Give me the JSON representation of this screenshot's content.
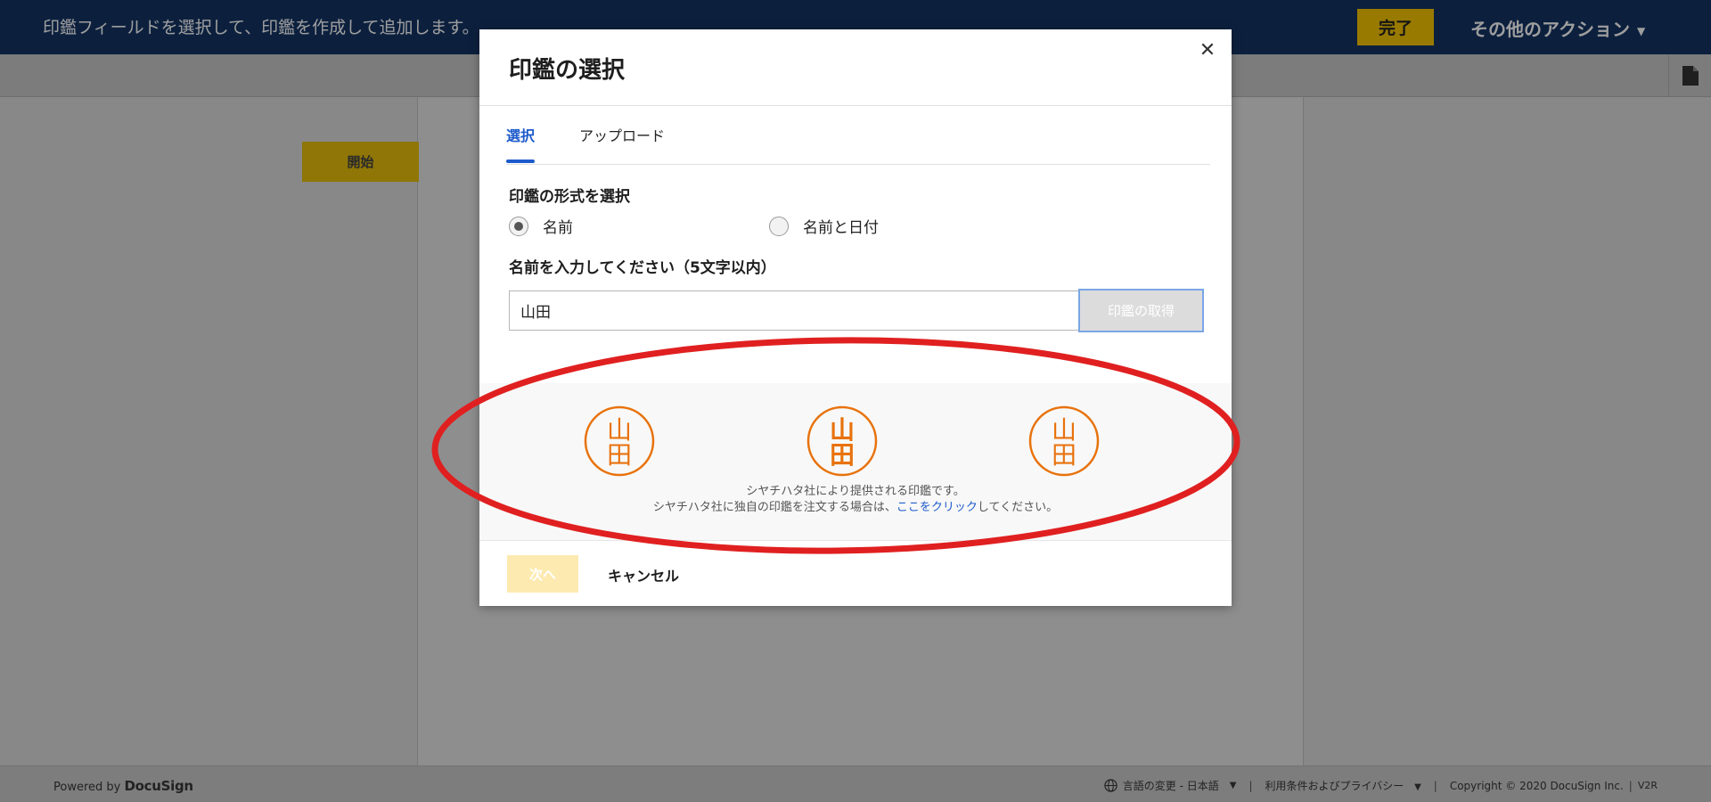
{
  "header": {
    "message": "印鑑フィールドを選択して、印鑑を作成して追加します。",
    "done_label": "完了",
    "other_actions_label": "その他のアクション",
    "other_actions_caret": "▼"
  },
  "toolbar": {
    "document_icon": "document-icon"
  },
  "document": {
    "start_label": "開始"
  },
  "modal": {
    "title": "印鑑の選択",
    "close_glyph": "✕",
    "tabs": [
      {
        "label": "選択",
        "active": true
      },
      {
        "label": "アップロード",
        "active": false
      }
    ],
    "format_label": "印鑑の形式を選択",
    "format_options": [
      {
        "label": "名前",
        "selected": true
      },
      {
        "label": "名前と日付",
        "selected": false
      }
    ],
    "name_label": "名前を入力してください（5文字以内）",
    "name_value": "山田",
    "get_seal_label": "印鑑の取得",
    "seals": [
      {
        "text": "山田",
        "style": "stacked-round"
      },
      {
        "text": "山田",
        "style": "stacked-compressed"
      },
      {
        "text": "山田",
        "style": "stacked-classic"
      }
    ],
    "provider_line1": "シヤチハタ社により提供される印鑑です。",
    "provider_line2_prefix": "シヤチハタ社に独自の印鑑を注文する場合は、",
    "provider_link": "ここをクリック",
    "provider_line2_suffix": "してください。",
    "next_label": "次へ",
    "cancel_label": "キャンセル"
  },
  "footer": {
    "powered_by": "Powered by",
    "brand": "DocuSign",
    "language": "言語の変更 - 日本語",
    "language_caret": "▼",
    "terms": "利用条件およびプライバシー",
    "terms_caret": "▼",
    "copyright": "Copyright © 2020 DocuSign Inc.",
    "version": "V2R",
    "separator": "|"
  },
  "colors": {
    "accent_yellow": "#f7c500",
    "link_blue": "#1e5bcc",
    "seal_orange": "#e8720c",
    "annotation_red": "#e02020"
  }
}
